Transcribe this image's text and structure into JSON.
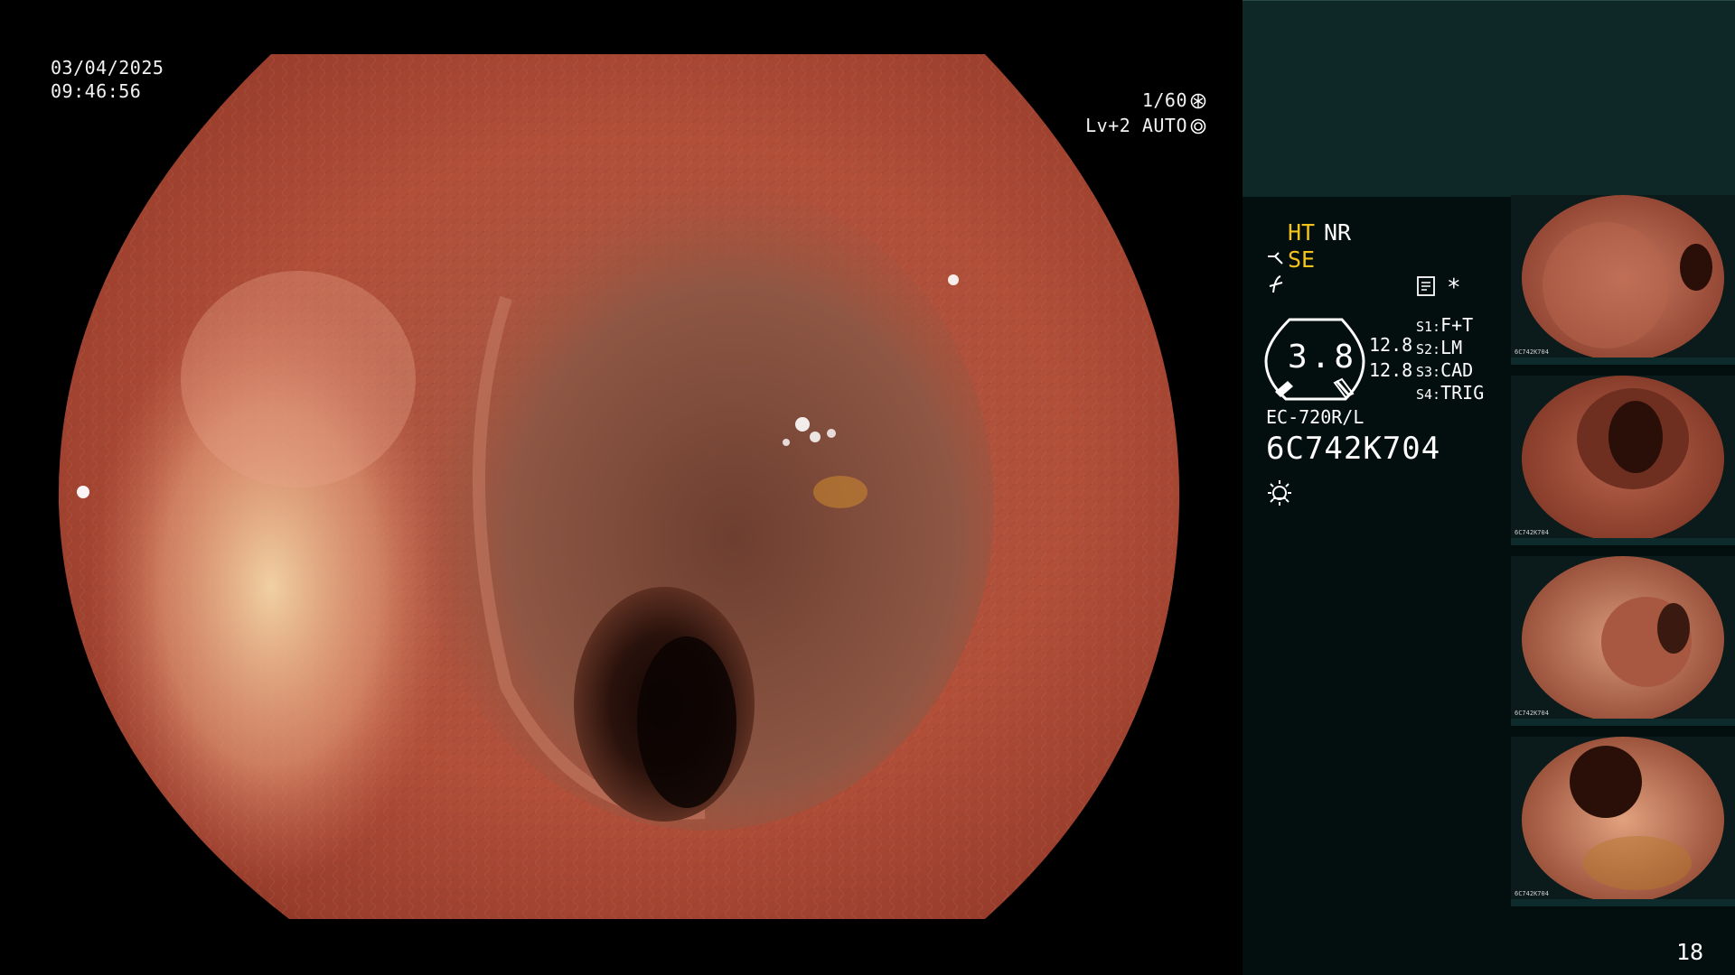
{
  "scope": {
    "date": "03/04/2025",
    "time": "09:46:56",
    "shutter": "1/60",
    "level": "Lv+2 AUTO"
  },
  "panel": {
    "ht": "HT",
    "nr": "NR",
    "se": "SE",
    "star": "*",
    "zoom": "3.8",
    "gauge_top": "12.8",
    "gauge_bottom": "12.8",
    "switches": [
      {
        "key": "S1:",
        "value": "F+T"
      },
      {
        "key": "S2:",
        "value": "LM"
      },
      {
        "key": "S3:",
        "value": "CAD"
      },
      {
        "key": "S4:",
        "value": "TRIG"
      }
    ],
    "model": "EC-720R/L",
    "serial": "6C742K704",
    "page": "18"
  },
  "thumbnails": [
    {
      "label": "6C742K704"
    },
    {
      "label": "6C742K704"
    },
    {
      "label": "6C742K704"
    },
    {
      "label": "6C742K704"
    }
  ],
  "colors": {
    "panel_bg": "#030f0f",
    "panel_header": "#0e2828",
    "accent_yellow": "#f4c21b",
    "mucosa": "#b5503c"
  }
}
